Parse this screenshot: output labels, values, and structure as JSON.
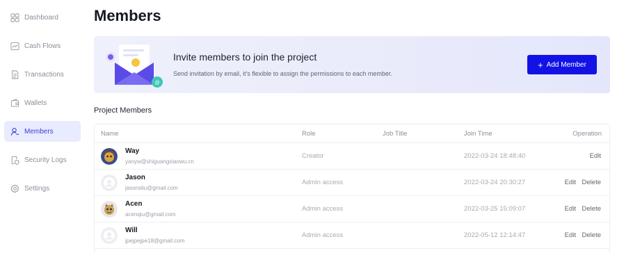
{
  "sidebar": {
    "items": [
      {
        "label": "Dashboard",
        "icon": "grid-icon"
      },
      {
        "label": "Cash Flows",
        "icon": "chart-icon"
      },
      {
        "label": "Transactions",
        "icon": "document-icon"
      },
      {
        "label": "Wallets",
        "icon": "wallet-icon"
      },
      {
        "label": "Members",
        "icon": "user-icon",
        "active": true
      },
      {
        "label": "Security Logs",
        "icon": "shield-log-icon"
      },
      {
        "label": "Settings",
        "icon": "gear-icon"
      }
    ]
  },
  "page": {
    "title": "Members"
  },
  "banner": {
    "title": "Invite members to join the project",
    "subtitle": "Send invitation by email, it's flexible to assign the permissions to each member.",
    "button": "Add Member"
  },
  "section": {
    "title": "Project Members"
  },
  "table": {
    "headers": [
      "Name",
      "Role",
      "Job Title",
      "Join Time",
      "Operation"
    ],
    "rows": [
      {
        "name": "Way",
        "email": "yanyw@shiguangxiaowu.cn",
        "role": "Creator",
        "job": "",
        "join": "2022-03-24 18:48:40",
        "ops": [
          "Edit"
        ]
      },
      {
        "name": "Jason",
        "email": "jasonsliu@gmail.com",
        "role": "Admin access",
        "job": "",
        "join": "2022-03-24 20:30:27",
        "ops": [
          "Edit",
          "Delete"
        ]
      },
      {
        "name": "Acen",
        "email": "acenqiu@gmail.com",
        "role": "Admin access",
        "job": "",
        "join": "2022-03-25 15:09:07",
        "ops": [
          "Edit",
          "Delete"
        ]
      },
      {
        "name": "Will",
        "email": "jpejpejpe18@gmail.com",
        "role": "Admin access",
        "job": "",
        "join": "2022-05-12 12:14:47",
        "ops": [
          "Edit",
          "Delete"
        ]
      }
    ]
  },
  "colors": {
    "accent": "#1212e6",
    "active_bg": "#e9ebff",
    "active_text": "#3b3fd8"
  }
}
